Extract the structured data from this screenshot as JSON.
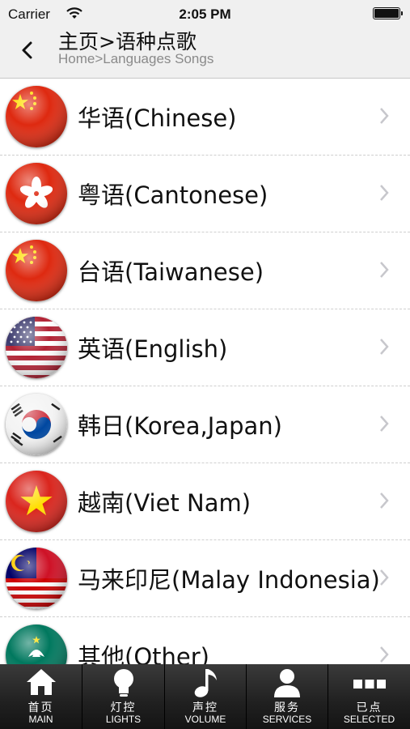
{
  "status_bar": {
    "carrier": "Carrier",
    "time": "2:05 PM"
  },
  "nav": {
    "title": "主页>语种点歌",
    "subtitle": "Home>Languages Songs"
  },
  "languages": [
    {
      "label": "华语(Chinese)",
      "flag_icon": "china-flag-icon"
    },
    {
      "label": "粤语(Cantonese)",
      "flag_icon": "hong-kong-flag-icon"
    },
    {
      "label": "台语(Taiwanese)",
      "flag_icon": "china-flag-icon"
    },
    {
      "label": "英语(English)",
      "flag_icon": "usa-flag-icon"
    },
    {
      "label": "韩日(Korea,Japan)",
      "flag_icon": "korea-flag-icon"
    },
    {
      "label": "越南(Viet Nam)",
      "flag_icon": "vietnam-flag-icon"
    },
    {
      "label": "马来印尼(Malay Indonesia)",
      "flag_icon": "malaysia-indonesia-flag-icon"
    },
    {
      "label": "其他(Other)",
      "flag_icon": "macau-flag-icon"
    }
  ],
  "tabs": [
    {
      "cn": "首页",
      "en": "MAIN",
      "icon": "home-icon"
    },
    {
      "cn": "灯控",
      "en": "LIGHTS",
      "icon": "light-bulb-icon"
    },
    {
      "cn": "声控",
      "en": "VOLUME",
      "icon": "music-note-icon"
    },
    {
      "cn": "服务",
      "en": "SERVICES",
      "icon": "person-icon"
    },
    {
      "cn": "已点",
      "en": "SELECTED",
      "icon": "more-icon"
    }
  ],
  "colors": {
    "bar_bg": "#f0f0f0",
    "tab_bg": "#1a1a1a",
    "chevron": "#c7c7cc"
  }
}
